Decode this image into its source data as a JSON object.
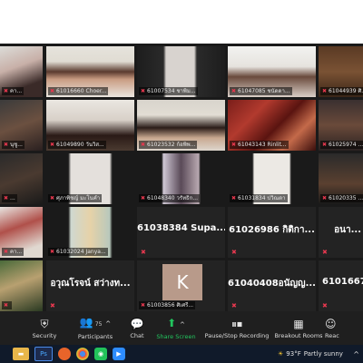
{
  "participants": [
    {
      "caption": "คา..."
    },
    {
      "caption": "61016660 Choer..."
    },
    {
      "caption": "61007534 ชาพิม..."
    },
    {
      "caption": "61047085 ชนัดดา..."
    },
    {
      "caption": "61044939 ศิ..."
    },
    {
      "caption": "นุชู..."
    },
    {
      "caption": "61049890 วันวิส..."
    },
    {
      "caption": "61023532 ก้อพิพ..."
    },
    {
      "caption": "61043143 Rinlit..."
    },
    {
      "caption": "61025974 ..."
    },
    {
      "caption": "..."
    },
    {
      "caption": "ศุภาพิชญ์ มะโนคำ"
    },
    {
      "caption": "61048340 วรัทธิก..."
    },
    {
      "caption": "61031834 ปวิณดา"
    },
    {
      "caption": "61020335 ..."
    },
    {
      "caption": "คา..."
    },
    {
      "caption": "61032024 Janya..."
    },
    {
      "name": "61038384 Supa..."
    },
    {
      "name": "61026986 กิติกา..."
    },
    {
      "name": "อนา..."
    },
    {
      "caption": ""
    },
    {
      "name": "อวุณโรจน์ สว่างท..."
    },
    {
      "caption": "61003856 ศิเศรี..."
    },
    {
      "name": "61040408อนัญญ..."
    },
    {
      "name": "6101667..."
    }
  ],
  "avatar_letter": "K",
  "mic_icon": "mic-muted-icon",
  "toolbar": {
    "security": "Security",
    "participants": "Participants",
    "participants_count": "75",
    "chat": "Chat",
    "share": "Share Screen",
    "record": "Pause/Stop Recording",
    "breakout": "Breakout Rooms",
    "reactions": "Reac"
  },
  "weather": {
    "temp": "93°F",
    "desc": "Partly sunny"
  },
  "colors": {
    "share_green": "#22c55e",
    "mic_red": "#e8384f"
  }
}
